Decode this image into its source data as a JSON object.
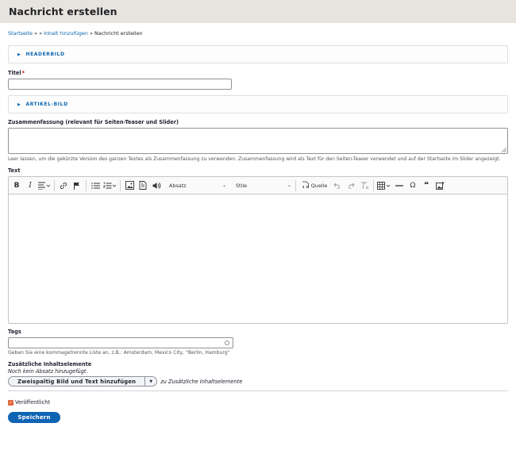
{
  "header": {
    "title": "Nachricht erstellen"
  },
  "breadcrumb": {
    "home": "Startseite",
    "sep1": "»",
    "sep2": "»",
    "add_content": "Inhalt hinzufügen",
    "sep3": "»",
    "current": "Nachricht erstellen"
  },
  "header_image": {
    "label": "HEADERBILD"
  },
  "title_field": {
    "label": "Titel",
    "required_mark": "*",
    "value": ""
  },
  "article_image": {
    "label": "ARTIKEL-BILD"
  },
  "summary": {
    "label": "Zusammenfassung (relevant für Seiten-Teaser und Slider)",
    "value": "",
    "description": "Leer lassen, um die gekürzte Version des ganzen Textes als Zusammenfassung zu verwenden. Zusammenfassung wird als Text für den Seiten-Teaser verwendet und auf der Startseite im Slider angezeigt."
  },
  "text_field": {
    "label": "Text",
    "toolbar": {
      "bold": "B",
      "italic": "I",
      "heading_dropdown": "Absatz",
      "style_dropdown": "Stile",
      "source_label": "Quelle",
      "omega": "Ω",
      "quote": "❝"
    }
  },
  "tags": {
    "label": "Tags",
    "value": "",
    "description": "Geben Sie eine kommagetrennte Liste an, z.B.: Amsterdam, Mexico City, \"Berlin, Hamburg\""
  },
  "extra": {
    "label": "Zusätzliche Inhaltselemente",
    "empty_note": "Noch kein Absatz hinzugefügt.",
    "add_button": "Zweispaltig Bild und Text hinzufügen",
    "after_text": "zu Zusätzliche Inhaltselemente"
  },
  "published": {
    "label": "Veröffentlicht",
    "checked": true
  },
  "save_button": "Speichern",
  "colors": {
    "link": "#0b66b1",
    "primary": "#0f64b4",
    "checkbox": "#e1653b",
    "header_bg": "#e7e4df"
  }
}
